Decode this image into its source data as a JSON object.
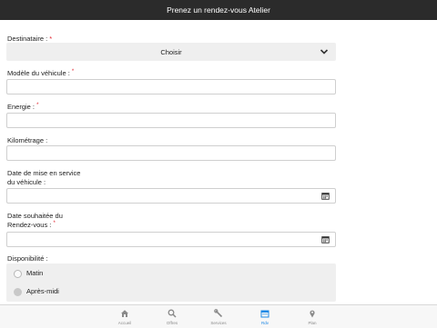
{
  "header": {
    "title": "Prenez un rendez-vous Atelier"
  },
  "form": {
    "destinataire": {
      "label": "Destinataire :",
      "required_mark": "*",
      "select_value": "Choisir"
    },
    "modele": {
      "label": "Modèle du véhicule :",
      "required_mark": "*",
      "value": ""
    },
    "energie": {
      "label": "Energie :",
      "required_mark": "*",
      "value": ""
    },
    "kilometrage": {
      "label": "Kilométrage :",
      "value": ""
    },
    "date_service": {
      "label_line1": "Date de mise en service",
      "label_line2": "du véhicule :",
      "value": ""
    },
    "date_rdv": {
      "label_line1": "Date souhaitée du",
      "label_line2": "Rendez-vous :",
      "required_mark": "*",
      "value": ""
    },
    "disponibilite": {
      "label": "Disponibilité :",
      "options": [
        {
          "label": "Matin",
          "selected": false
        },
        {
          "label": "Après-midi",
          "selected": false
        }
      ]
    }
  },
  "tabbar": {
    "items": [
      {
        "label": "Accueil",
        "icon": "home-icon",
        "active": false
      },
      {
        "label": "Offres",
        "icon": "search-icon",
        "active": false
      },
      {
        "label": "Services",
        "icon": "wrench-icon",
        "active": false
      },
      {
        "label": "Rdv",
        "icon": "calendar-icon",
        "active": true
      },
      {
        "label": "Plan",
        "icon": "map-pin-icon",
        "active": false
      }
    ]
  },
  "colors": {
    "active_tab": "#1e88e5",
    "required": "#e0202a",
    "header_bg": "#2b2b2b"
  }
}
